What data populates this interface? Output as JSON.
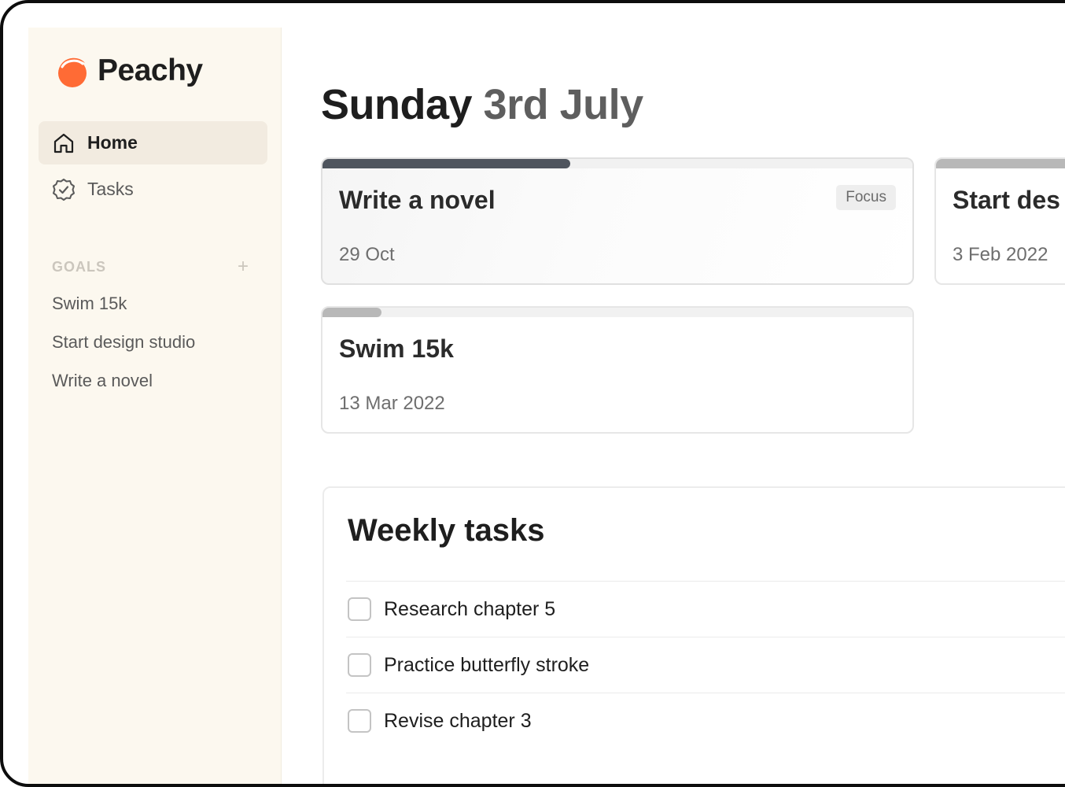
{
  "app": {
    "name": "Peachy",
    "brand_color": "#ff6b35"
  },
  "sidebar": {
    "nav": [
      {
        "label": "Home",
        "icon": "home-icon",
        "active": true
      },
      {
        "label": "Tasks",
        "icon": "badge-check-icon",
        "active": false
      }
    ],
    "goals_title": "GOALS",
    "goals_add_icon": "plus-icon",
    "goals": [
      {
        "label": "Swim 15k"
      },
      {
        "label": "Start design studio"
      },
      {
        "label": "Write a novel"
      }
    ]
  },
  "main": {
    "date_day": "Sunday",
    "date_rest": " 3rd July",
    "goal_cards": [
      {
        "title": "Write a novel",
        "date": "29 Oct",
        "badge": "Focus",
        "progress": 0.42,
        "progress_color": "#4f555e"
      },
      {
        "title": "Start des",
        "date": "3 Feb 2022",
        "progress": 0.43,
        "progress_color": "#b8b8b8"
      },
      {
        "title": "Swim 15k",
        "date": "13 Mar 2022",
        "progress": 0.1,
        "progress_color": "#b8b8b8"
      }
    ],
    "weekly": {
      "title": "Weekly tasks",
      "tasks": [
        {
          "label": "Research chapter 5",
          "done": false
        },
        {
          "label": "Practice butterfly stroke",
          "done": false
        },
        {
          "label": "Revise chapter 3",
          "done": false
        }
      ]
    }
  }
}
